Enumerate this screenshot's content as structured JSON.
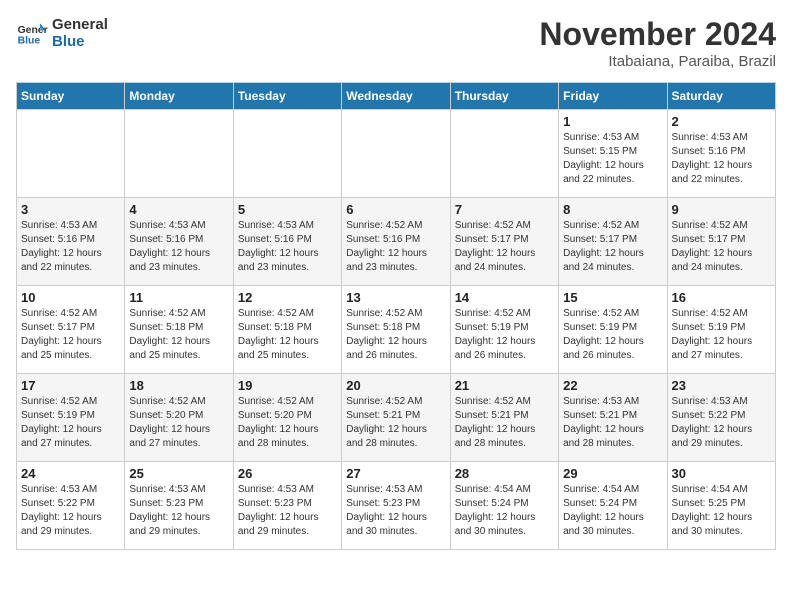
{
  "logo": {
    "line1": "General",
    "line2": "Blue"
  },
  "header": {
    "month": "November 2024",
    "location": "Itabaiana, Paraiba, Brazil"
  },
  "weekdays": [
    "Sunday",
    "Monday",
    "Tuesday",
    "Wednesday",
    "Thursday",
    "Friday",
    "Saturday"
  ],
  "weeks": [
    [
      {
        "day": "",
        "info": ""
      },
      {
        "day": "",
        "info": ""
      },
      {
        "day": "",
        "info": ""
      },
      {
        "day": "",
        "info": ""
      },
      {
        "day": "",
        "info": ""
      },
      {
        "day": "1",
        "info": "Sunrise: 4:53 AM\nSunset: 5:15 PM\nDaylight: 12 hours\nand 22 minutes."
      },
      {
        "day": "2",
        "info": "Sunrise: 4:53 AM\nSunset: 5:16 PM\nDaylight: 12 hours\nand 22 minutes."
      }
    ],
    [
      {
        "day": "3",
        "info": "Sunrise: 4:53 AM\nSunset: 5:16 PM\nDaylight: 12 hours\nand 22 minutes."
      },
      {
        "day": "4",
        "info": "Sunrise: 4:53 AM\nSunset: 5:16 PM\nDaylight: 12 hours\nand 23 minutes."
      },
      {
        "day": "5",
        "info": "Sunrise: 4:53 AM\nSunset: 5:16 PM\nDaylight: 12 hours\nand 23 minutes."
      },
      {
        "day": "6",
        "info": "Sunrise: 4:52 AM\nSunset: 5:16 PM\nDaylight: 12 hours\nand 23 minutes."
      },
      {
        "day": "7",
        "info": "Sunrise: 4:52 AM\nSunset: 5:17 PM\nDaylight: 12 hours\nand 24 minutes."
      },
      {
        "day": "8",
        "info": "Sunrise: 4:52 AM\nSunset: 5:17 PM\nDaylight: 12 hours\nand 24 minutes."
      },
      {
        "day": "9",
        "info": "Sunrise: 4:52 AM\nSunset: 5:17 PM\nDaylight: 12 hours\nand 24 minutes."
      }
    ],
    [
      {
        "day": "10",
        "info": "Sunrise: 4:52 AM\nSunset: 5:17 PM\nDaylight: 12 hours\nand 25 minutes."
      },
      {
        "day": "11",
        "info": "Sunrise: 4:52 AM\nSunset: 5:18 PM\nDaylight: 12 hours\nand 25 minutes."
      },
      {
        "day": "12",
        "info": "Sunrise: 4:52 AM\nSunset: 5:18 PM\nDaylight: 12 hours\nand 25 minutes."
      },
      {
        "day": "13",
        "info": "Sunrise: 4:52 AM\nSunset: 5:18 PM\nDaylight: 12 hours\nand 26 minutes."
      },
      {
        "day": "14",
        "info": "Sunrise: 4:52 AM\nSunset: 5:19 PM\nDaylight: 12 hours\nand 26 minutes."
      },
      {
        "day": "15",
        "info": "Sunrise: 4:52 AM\nSunset: 5:19 PM\nDaylight: 12 hours\nand 26 minutes."
      },
      {
        "day": "16",
        "info": "Sunrise: 4:52 AM\nSunset: 5:19 PM\nDaylight: 12 hours\nand 27 minutes."
      }
    ],
    [
      {
        "day": "17",
        "info": "Sunrise: 4:52 AM\nSunset: 5:19 PM\nDaylight: 12 hours\nand 27 minutes."
      },
      {
        "day": "18",
        "info": "Sunrise: 4:52 AM\nSunset: 5:20 PM\nDaylight: 12 hours\nand 27 minutes."
      },
      {
        "day": "19",
        "info": "Sunrise: 4:52 AM\nSunset: 5:20 PM\nDaylight: 12 hours\nand 28 minutes."
      },
      {
        "day": "20",
        "info": "Sunrise: 4:52 AM\nSunset: 5:21 PM\nDaylight: 12 hours\nand 28 minutes."
      },
      {
        "day": "21",
        "info": "Sunrise: 4:52 AM\nSunset: 5:21 PM\nDaylight: 12 hours\nand 28 minutes."
      },
      {
        "day": "22",
        "info": "Sunrise: 4:53 AM\nSunset: 5:21 PM\nDaylight: 12 hours\nand 28 minutes."
      },
      {
        "day": "23",
        "info": "Sunrise: 4:53 AM\nSunset: 5:22 PM\nDaylight: 12 hours\nand 29 minutes."
      }
    ],
    [
      {
        "day": "24",
        "info": "Sunrise: 4:53 AM\nSunset: 5:22 PM\nDaylight: 12 hours\nand 29 minutes."
      },
      {
        "day": "25",
        "info": "Sunrise: 4:53 AM\nSunset: 5:23 PM\nDaylight: 12 hours\nand 29 minutes."
      },
      {
        "day": "26",
        "info": "Sunrise: 4:53 AM\nSunset: 5:23 PM\nDaylight: 12 hours\nand 29 minutes."
      },
      {
        "day": "27",
        "info": "Sunrise: 4:53 AM\nSunset: 5:23 PM\nDaylight: 12 hours\nand 30 minutes."
      },
      {
        "day": "28",
        "info": "Sunrise: 4:54 AM\nSunset: 5:24 PM\nDaylight: 12 hours\nand 30 minutes."
      },
      {
        "day": "29",
        "info": "Sunrise: 4:54 AM\nSunset: 5:24 PM\nDaylight: 12 hours\nand 30 minutes."
      },
      {
        "day": "30",
        "info": "Sunrise: 4:54 AM\nSunset: 5:25 PM\nDaylight: 12 hours\nand 30 minutes."
      }
    ]
  ]
}
